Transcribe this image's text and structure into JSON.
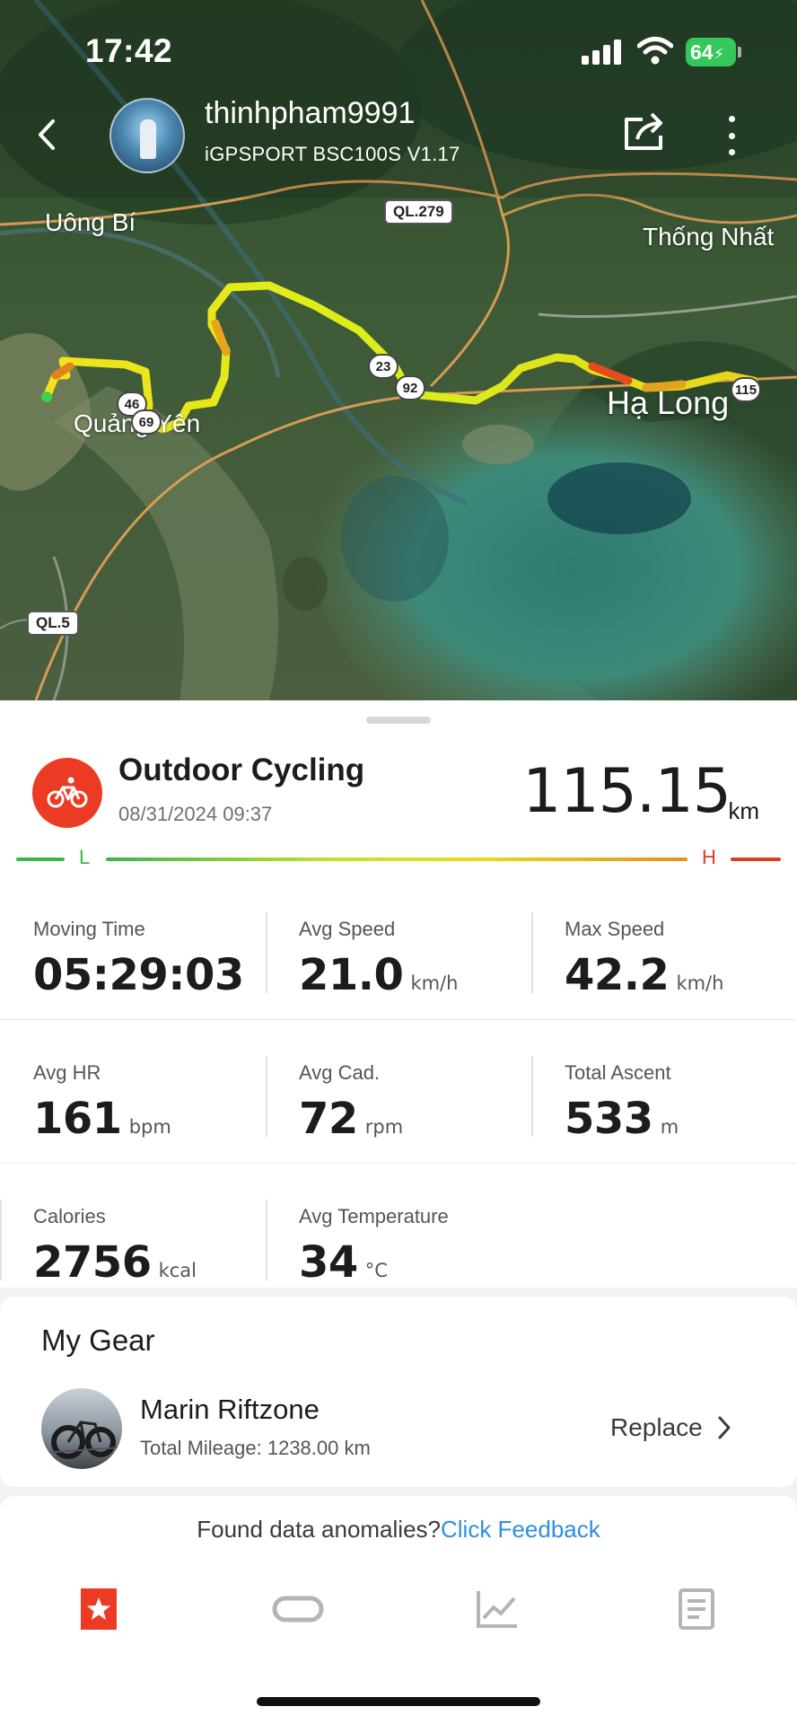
{
  "status_bar": {
    "time": "17:42",
    "battery": "64"
  },
  "header": {
    "username": "thinhpham9991",
    "device": "iGPSPORT BSC100S V1.17"
  },
  "map": {
    "places": [
      "Uông Bí",
      "Thống Nhất",
      "Quảng Yên",
      "Hạ Long"
    ],
    "road_signs": [
      "QL.279",
      "QL.5"
    ],
    "road_numbers": [
      "23",
      "92",
      "46",
      "69",
      "115"
    ]
  },
  "activity": {
    "type": "Outdoor Cycling",
    "date": "08/31/2024 09:37",
    "distance": "115.15",
    "distance_unit": "km",
    "gradient_low": "L",
    "gradient_high": "H",
    "colors": {
      "accent": "#ec3b24",
      "low": "#3ab54a",
      "mid": "#e6e21a",
      "high": "#e33a1e"
    }
  },
  "stats": [
    [
      {
        "label": "Moving Time",
        "value": "05:29:03",
        "unit": ""
      },
      {
        "label": "Avg Speed",
        "value": "21.0",
        "unit": "km/h"
      },
      {
        "label": "Max Speed",
        "value": "42.2",
        "unit": "km/h"
      }
    ],
    [
      {
        "label": "Avg HR",
        "value": "161",
        "unit": "bpm"
      },
      {
        "label": "Avg Cad.",
        "value": "72",
        "unit": "rpm"
      },
      {
        "label": "Total Ascent",
        "value": "533",
        "unit": "m"
      }
    ],
    [
      {
        "label": "Calories",
        "value": "2756",
        "unit": "kcal"
      },
      {
        "label": "Avg Temperature",
        "value": "34",
        "unit": "°C"
      }
    ]
  ],
  "gear": {
    "title": "My Gear",
    "name": "Marin Riftzone",
    "mileage": "Total Mileage: 1238.00 km",
    "replace_label": "Replace"
  },
  "feedback": {
    "text": "Found data anomalies?",
    "link": "Click Feedback"
  },
  "tabs": [
    {
      "icon": "star-bookmark-icon",
      "active": true
    },
    {
      "icon": "lap-track-icon",
      "active": false
    },
    {
      "icon": "line-chart-icon",
      "active": false
    },
    {
      "icon": "document-icon",
      "active": false
    }
  ]
}
